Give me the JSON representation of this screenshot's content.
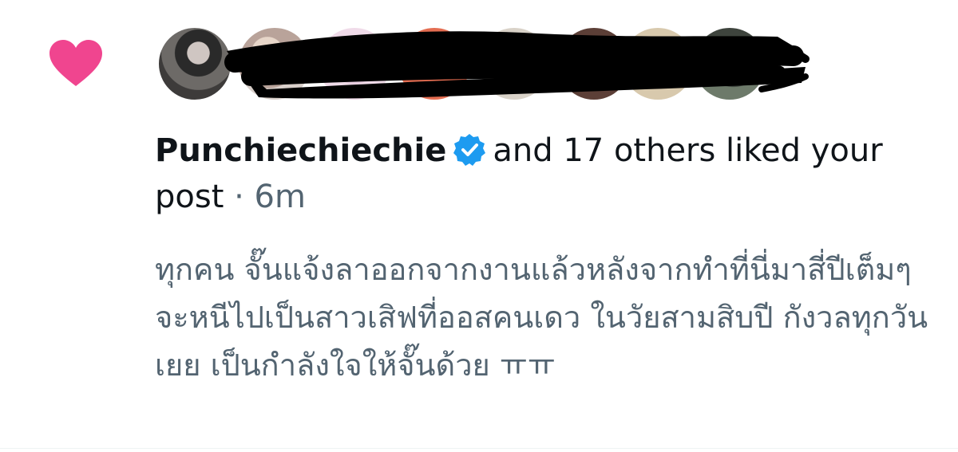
{
  "notification": {
    "type": "like",
    "heart_icon": "heart-icon",
    "heart_color": "#f0458f",
    "avatars_count": 8,
    "username": "Punchiechiechie",
    "verified_icon": "verified-badge-icon",
    "verified_color": "#1d9bf0",
    "action_text": "and 17 others liked your post",
    "separator": "·",
    "time": "6m",
    "post_text": "ทุกคน จั๊นแจ้งลาออกจากงานแล้วหลังจากทำที่นี่มาสี่ปีเต็มๆ จะหนีไปเป็นสาวเสิฟที่ออสคนเดว ในวัยสามสิบปี กังวลทุกวันเยย เป็นกำลังใจให้จั๊นด้วย ㅠㅠ"
  },
  "colors": {
    "text_primary": "#0f1419",
    "text_secondary": "#536471",
    "background": "#ffffff",
    "redaction": "#000000"
  }
}
